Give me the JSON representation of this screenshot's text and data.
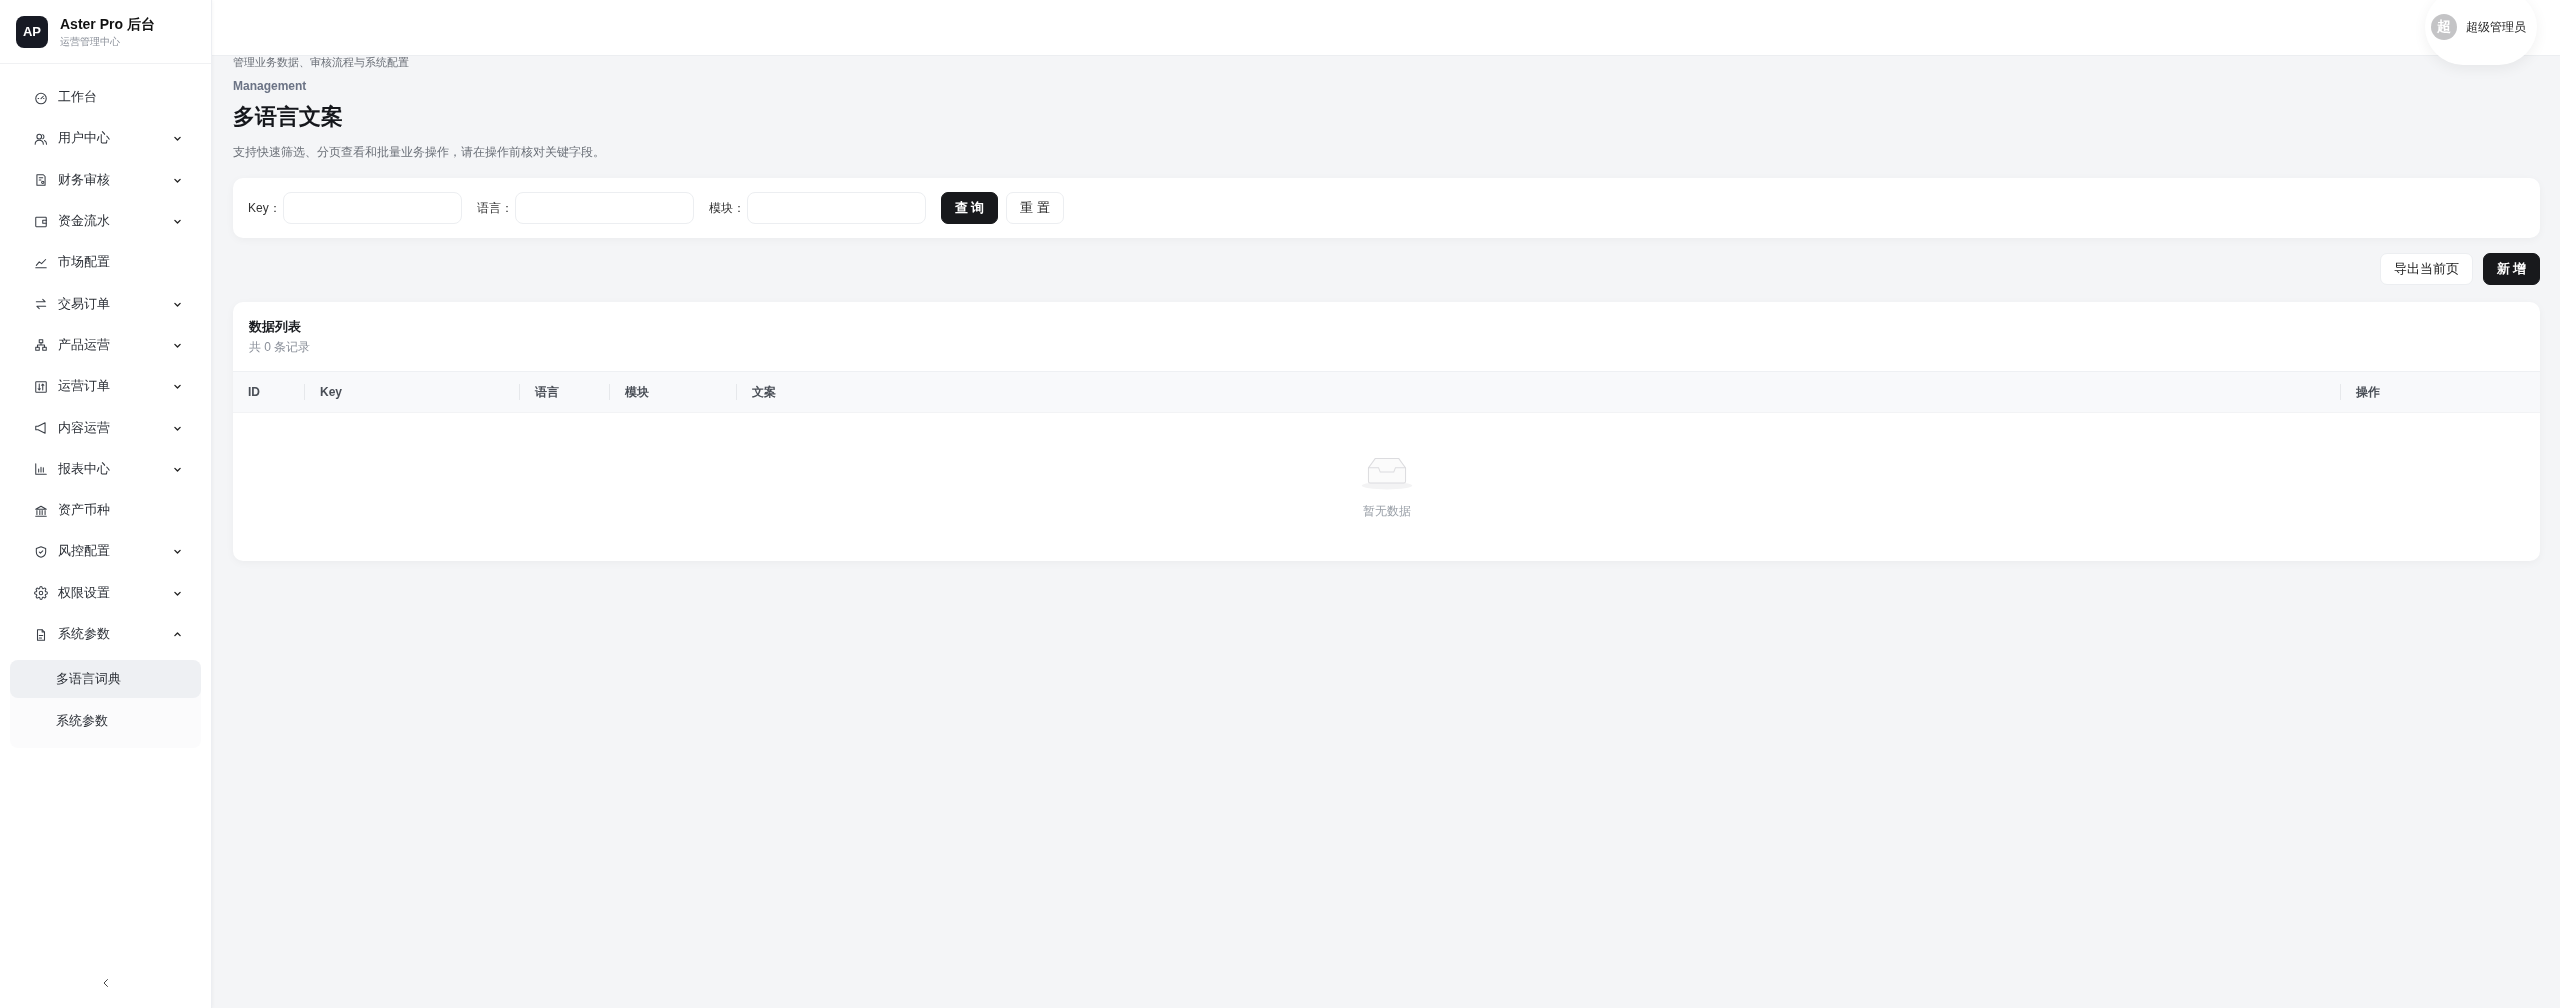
{
  "sidebar": {
    "logo": {
      "mark": "AP",
      "title": "Aster Pro 后台",
      "subtitle": "运营管理中心"
    },
    "items": [
      {
        "label": "工作台",
        "kind": "link",
        "selected": false
      },
      {
        "label": "用户中心",
        "kind": "group",
        "expanded": false,
        "selected": false
      },
      {
        "label": "财务审核",
        "kind": "group",
        "expanded": false,
        "selected": false
      },
      {
        "label": "资金流水",
        "kind": "group",
        "expanded": false,
        "selected": false
      },
      {
        "label": "市场配置",
        "kind": "link",
        "selected": false
      },
      {
        "label": "交易订单",
        "kind": "group",
        "expanded": false,
        "selected": false
      },
      {
        "label": "产品运营",
        "kind": "group",
        "expanded": false,
        "selected": false
      },
      {
        "label": "运营订单",
        "kind": "group",
        "expanded": false,
        "selected": false
      },
      {
        "label": "内容运营",
        "kind": "group",
        "expanded": false,
        "selected": false
      },
      {
        "label": "报表中心",
        "kind": "group",
        "expanded": false,
        "selected": false
      },
      {
        "label": "资产币种",
        "kind": "link",
        "selected": false
      },
      {
        "label": "风控配置",
        "kind": "group",
        "expanded": false,
        "selected": false
      },
      {
        "label": "权限设置",
        "kind": "group",
        "expanded": false,
        "selected": false
      },
      {
        "label": "系统参数",
        "kind": "group",
        "expanded": true,
        "selected": false,
        "children": [
          {
            "label": "多语言词典",
            "selected": true
          },
          {
            "label": "系统参数",
            "selected": false
          }
        ]
      }
    ]
  },
  "header": {
    "user": {
      "avatar": "超",
      "name": "超级管理员"
    }
  },
  "page": {
    "subtitle": "管理业务数据、审核流程与系统配置",
    "eyebrow": "Management",
    "title": "多语言文案",
    "description": "支持快速筛选、分页查看和批量业务操作，请在操作前核对关键字段。"
  },
  "filter": {
    "fields": [
      {
        "label": "Key："
      },
      {
        "label": "语言："
      },
      {
        "label": "模块："
      }
    ],
    "buttons": [
      {
        "label": "查 询",
        "kind": "primary"
      },
      {
        "label": "重 置",
        "kind": "default"
      }
    ]
  },
  "toolbar": {
    "buttons": [
      {
        "label": "导出当前页",
        "kind": "default"
      },
      {
        "label": "新 增",
        "kind": "primary"
      }
    ]
  },
  "table": {
    "title": "数据列表",
    "count": "共 0 条记录",
    "columns": [
      "ID",
      "Key",
      "语言",
      "模块",
      "文案",
      "操作"
    ],
    "empty": {
      "text": "暂无数据"
    }
  }
}
